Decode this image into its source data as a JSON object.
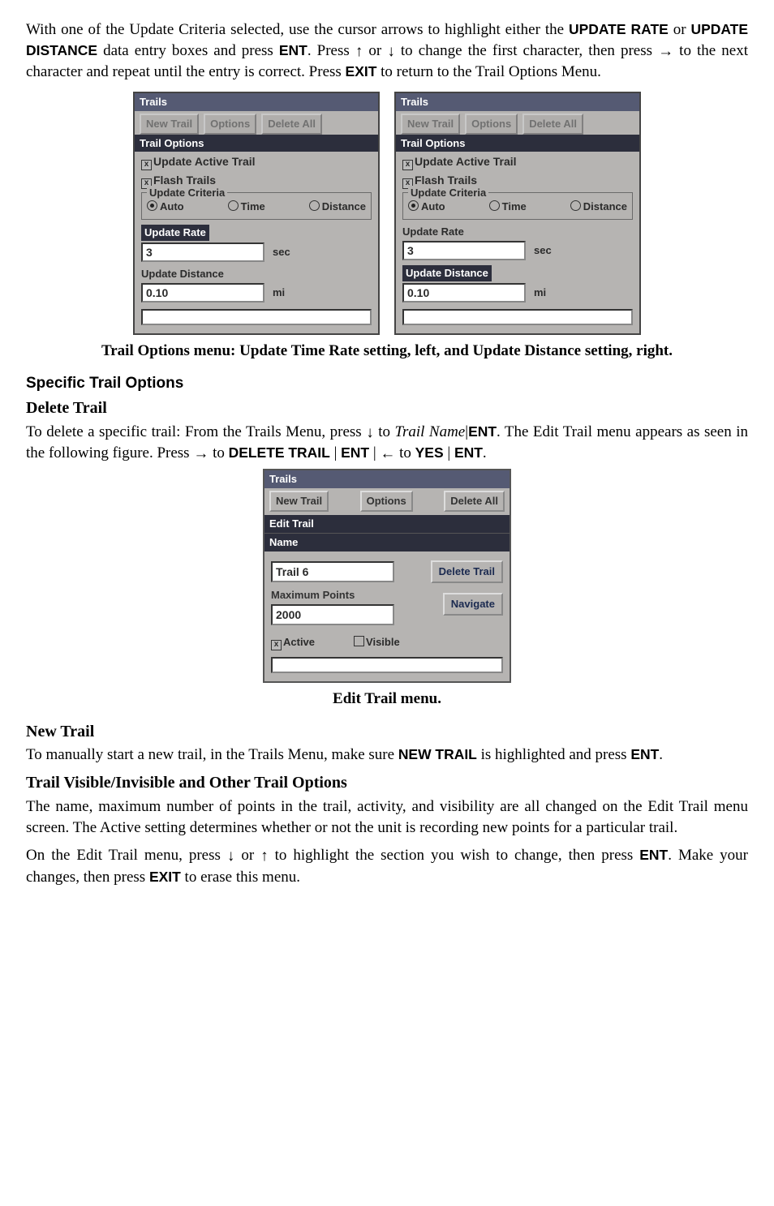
{
  "para1": {
    "a": "With one of the Update Criteria selected, use the cursor arrows to highlight either the ",
    "rate": "UPDATE RATE",
    "b": " or ",
    "dist": "UPDATE DISTANCE",
    "c": " data entry boxes and press ",
    "ent": "ENT",
    "d": ". Press ",
    "up": "↑",
    "e": " or ",
    "down": "↓",
    "f": "  to change the first character, then press ",
    "right": "→",
    "g": " to the next character and repeat until the entry is correct. Press ",
    "exit": "EXIT",
    "h": " to return to the Trail Options Menu."
  },
  "ss": {
    "title": "Trails",
    "trailopts": "Trail Options",
    "tabs": {
      "new": "New Trail",
      "opt": "Options",
      "del": "Delete All"
    },
    "update_active": "Update Active Trail",
    "flash_trails": "Flash Trails",
    "criteria": "Update Criteria",
    "auto": "Auto",
    "time": "Time",
    "distance": "Distance",
    "update_rate": "Update Rate",
    "rate_val": "3",
    "rate_unit": "sec",
    "update_distance": "Update Distance",
    "dist_val": "0.10",
    "dist_unit": "mi"
  },
  "caption1": "Trail Options menu: Update Time Rate setting, left, and Update Distance setting, right.",
  "h_specific": "Specific Trail Options",
  "h_delete": "Delete Trail",
  "para2": {
    "a": "To delete a specific trail: From the Trails Menu, press ",
    "down": "↓",
    "b": "  to ",
    "tn": "Trail Name",
    "pipe": "|",
    "ent": "ENT",
    "c": ". The Edit Trail menu appears as seen in the following figure. Press ",
    "right": "→",
    "d": " to ",
    "del": "DELETE TRAIL",
    "e": " | ",
    "ent2": "ENT",
    "f": " | ",
    "left": "←",
    "g": " to ",
    "yes": "YES",
    "h": " | ",
    "ent3": "ENT",
    "i": "."
  },
  "ss2": {
    "title": "Trails",
    "tabs": {
      "new": "New Trail",
      "opt": "Options",
      "del": "Delete All"
    },
    "edit": "Edit Trail",
    "name": "Name",
    "name_val": "Trail 6",
    "del_btn": "Delete Trail",
    "max": "Maximum Points",
    "max_val": "2000",
    "nav": "Navigate",
    "active": "Active",
    "visible": "Visible"
  },
  "caption2": "Edit Trail menu.",
  "h_newtrail": "New Trail",
  "para3": {
    "a": "To manually start a new trail, in the Trails Menu, make sure ",
    "nt": "NEW TRAIL",
    "b": " is highlighted and press ",
    "ent": "ENT",
    "c": "."
  },
  "h_visible": "Trail Visible/Invisible and Other Trail Options",
  "para4": "The name, maximum number of points in the trail, activity, and visibility are all changed on the Edit Trail menu screen. The Active setting determines whether or not the unit is recording new points for a particular trail.",
  "para5": {
    "a": "On the Edit Trail menu, press ",
    "down": "↓",
    "b": " or ",
    "up": "↑",
    "c": " to highlight the section you wish to change, then press ",
    "ent": "ENT",
    "d": ". Make your changes, then press ",
    "exit": "EXIT",
    "e": " to erase this menu."
  }
}
